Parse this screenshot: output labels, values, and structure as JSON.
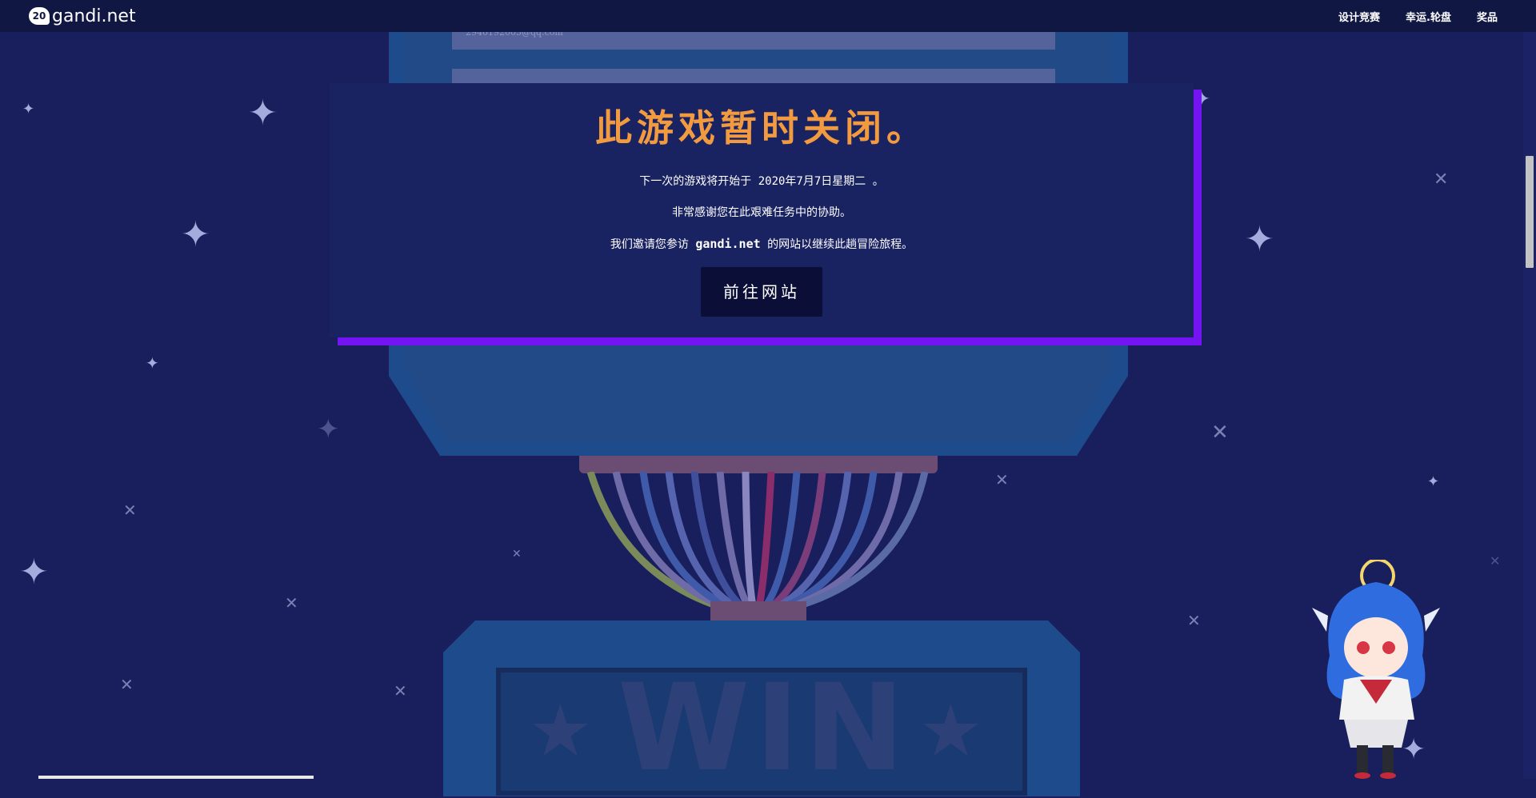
{
  "header": {
    "logo_text": "gandi.net",
    "logo_badge": "20",
    "nav": [
      "设计竞赛",
      "幸运.轮盘",
      "奖品"
    ]
  },
  "form": {
    "email_value": "2940192005@qq.com"
  },
  "dialog": {
    "title": "此游戏暂时关闭。",
    "line1": "下一次的游戏将开始于 2020年7月7日星期二 。",
    "line2": "非常感谢您在此艰难任务中的协助。",
    "line3_before": "我们邀请您参访",
    "line3_site": "gandi.net",
    "line3_after": "的网站以继续此趟冒险旅程。",
    "button_label": "前往网站"
  },
  "machine": {
    "screen_text": "WIN"
  },
  "colors": {
    "background": "#181f5c",
    "title_orange": "#f19a40",
    "dialog_shadow_purple": "#7414f2",
    "button_dark": "#0b0f38"
  }
}
